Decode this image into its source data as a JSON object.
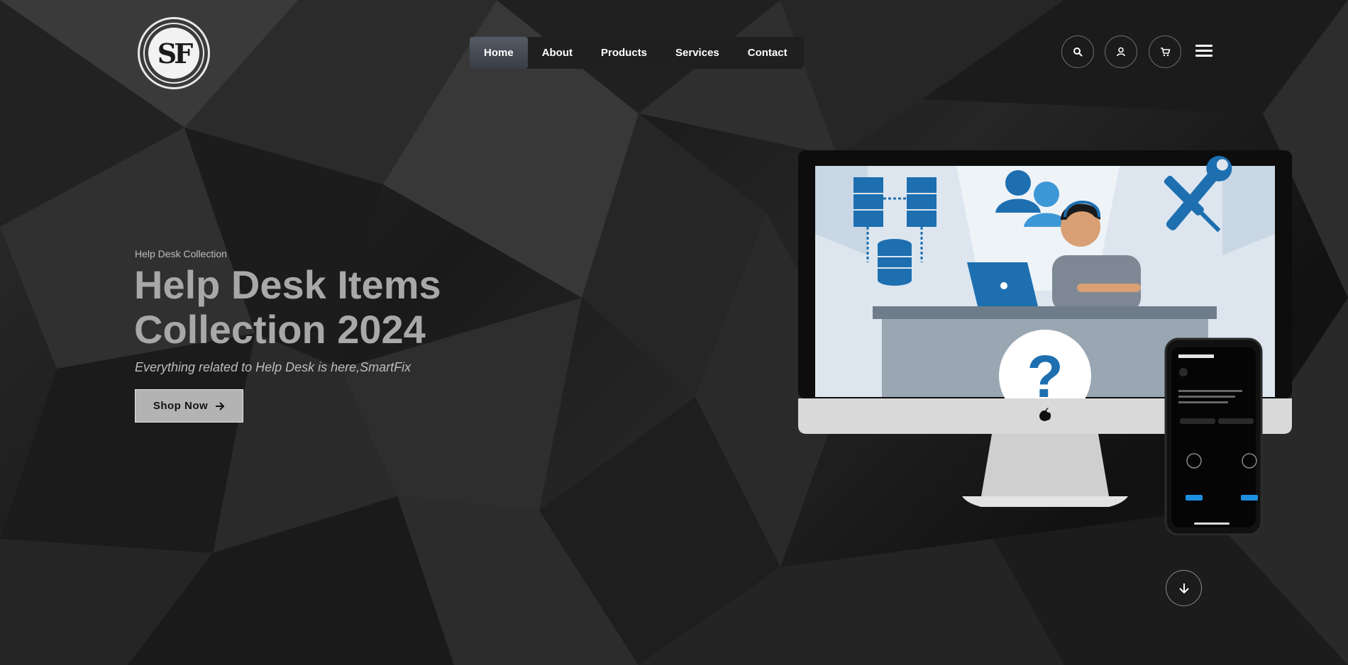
{
  "header": {
    "logo_text": "SF",
    "nav": [
      {
        "label": "Home",
        "active": true
      },
      {
        "label": "About",
        "active": false
      },
      {
        "label": "Products",
        "active": false
      },
      {
        "label": "Services",
        "active": false
      },
      {
        "label": "Contact",
        "active": false
      }
    ],
    "icons": [
      "search-icon",
      "user-icon",
      "cart-icon",
      "menu-icon"
    ]
  },
  "hero": {
    "eyebrow": "Help Desk Collection",
    "title_line1": "Help Desk Items",
    "title_line2": "Collection 2024",
    "subtitle": "Everything related to Help Desk is here,SmartFix",
    "cta_label": "Shop Now",
    "image_question_mark": "?"
  },
  "colors": {
    "background": "#141414",
    "nav_active": "#4a4e58",
    "title": "#a8a8a8",
    "cta_bg": "#b3b3b3",
    "illustration_blue": "#1d6fb0"
  }
}
